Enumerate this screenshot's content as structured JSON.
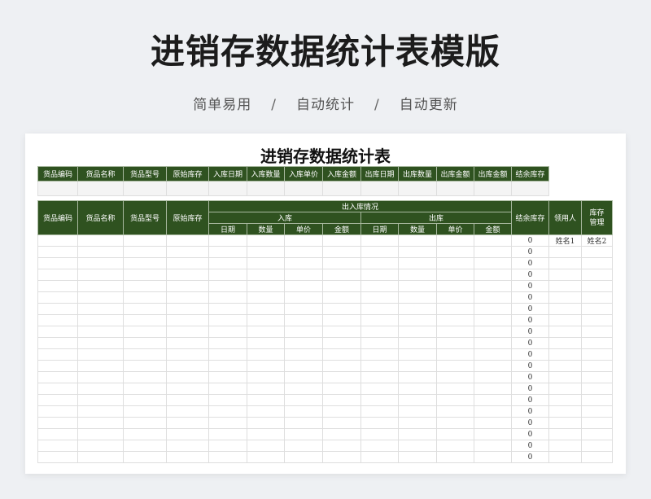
{
  "header": {
    "title": "进销存数据统计表模版",
    "tags": [
      "简单易用",
      "自动统计",
      "自动更新"
    ],
    "separator": "/"
  },
  "sheet": {
    "title": "进销存数据统计表",
    "summary_headers": [
      "货品编码",
      "货品名称",
      "货品型号",
      "原始库存",
      "入库日期",
      "入库数量",
      "入库单价",
      "入库金额",
      "出库日期",
      "出库数量",
      "出库金额",
      "出库金额",
      "结余库存"
    ],
    "detail": {
      "left_headers": [
        "货品编码",
        "货品名称",
        "货品型号",
        "原始库存"
      ],
      "group_header": "出入库情况",
      "in_header": "入库",
      "out_header": "出库",
      "sub_headers": [
        "日期",
        "数量",
        "单价",
        "金额",
        "日期",
        "数量",
        "单价",
        "金额"
      ],
      "right_headers": [
        "结余库存",
        "领用人",
        "库存管理"
      ],
      "first_row_names": [
        "姓名1",
        "姓名2"
      ],
      "balance_values": [
        "0",
        "0",
        "0",
        "0",
        "0",
        "0",
        "0",
        "0",
        "0",
        "0",
        "0",
        "0",
        "0",
        "0",
        "0",
        "0",
        "0",
        "0",
        "0",
        "0"
      ]
    }
  },
  "colors": {
    "header_bg": "#2f5220",
    "page_bg": "#eef0f3"
  }
}
